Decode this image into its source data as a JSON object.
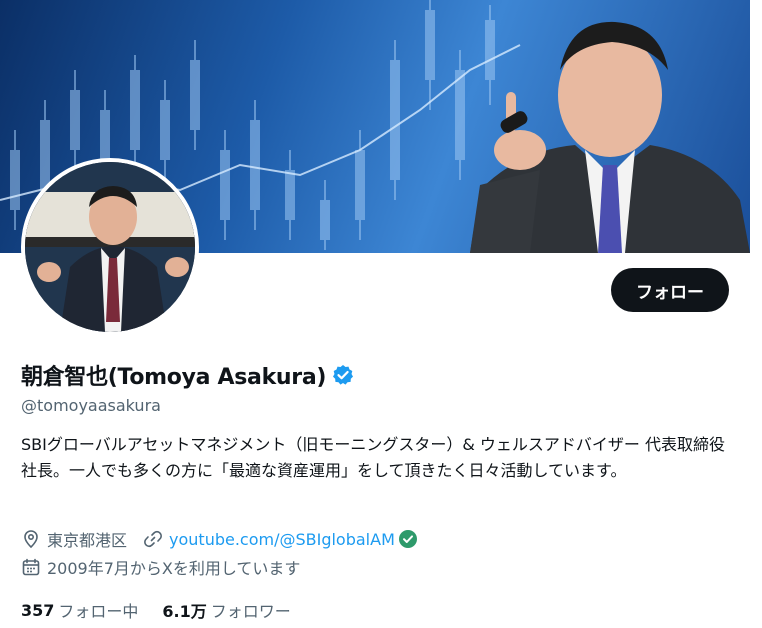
{
  "profile": {
    "display_name": "朝倉智也(Tomoya Asakura)",
    "handle": "@tomoyaasakura",
    "bio": "SBIグローバルアセットマネジメント（旧モーニングスター）& ウェルスアドバイザー 代表取締役社長。一人でも多くの方に「最適な資産運用」をして頂きたく日々活動しています。",
    "location": "東京都港区",
    "website": "youtube.com/@SBIglobalAM",
    "joined": "2009年7月からXを利用しています",
    "verified_icon": "verified-badge-icon",
    "website_verified_icon": "green-check-icon"
  },
  "actions": {
    "follow_label": "フォロー"
  },
  "stats": {
    "following_count": "357",
    "following_label": "フォロー中",
    "followers_count": "6.1万",
    "followers_label": "フォロワー"
  },
  "colors": {
    "accent": "#1d9bf0",
    "text_primary": "#0f1419",
    "text_secondary": "#536471",
    "verified_green": "#2e9a6b",
    "button_bg": "#0f1419"
  },
  "icons": {
    "location": "map-pin-icon",
    "link": "link-icon",
    "calendar": "calendar-icon"
  }
}
